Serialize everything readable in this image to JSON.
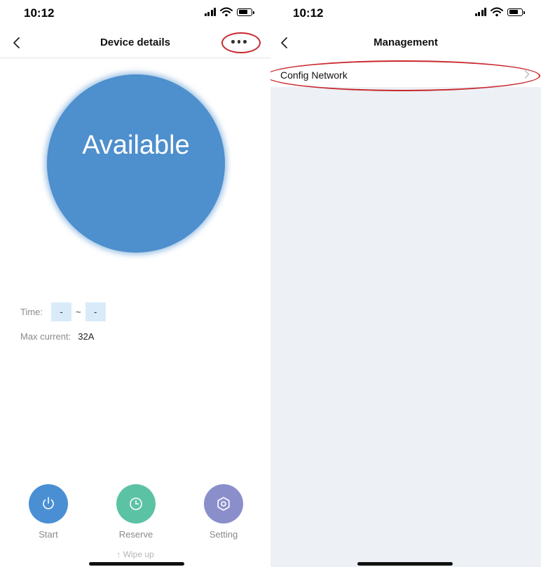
{
  "left_screen": {
    "status_bar": {
      "time": "10:12"
    },
    "nav": {
      "title": "Device details"
    },
    "device": {
      "status": "Available"
    },
    "info": {
      "time_label": "Time:",
      "time_start": "-",
      "time_separator": "~",
      "time_end": "-",
      "max_current_label": "Max current:",
      "max_current_value": "32A"
    },
    "actions": [
      {
        "label": "Start",
        "icon": "power-icon",
        "color": "#4a8fd4"
      },
      {
        "label": "Reserve",
        "icon": "clock-icon",
        "color": "#5cc2a4"
      },
      {
        "label": "Setting",
        "icon": "gear-icon",
        "color": "#8a8fcc"
      }
    ],
    "wipe_hint": "↑ Wipe up"
  },
  "right_screen": {
    "status_bar": {
      "time": "10:12"
    },
    "nav": {
      "title": "Management"
    },
    "items": [
      {
        "label": "Config Network"
      }
    ]
  },
  "colors": {
    "status_circle": "#4e8fcd",
    "annotation": "#c8282d",
    "page_background": "#edf0f5",
    "time_box": "#d9ebf9"
  }
}
